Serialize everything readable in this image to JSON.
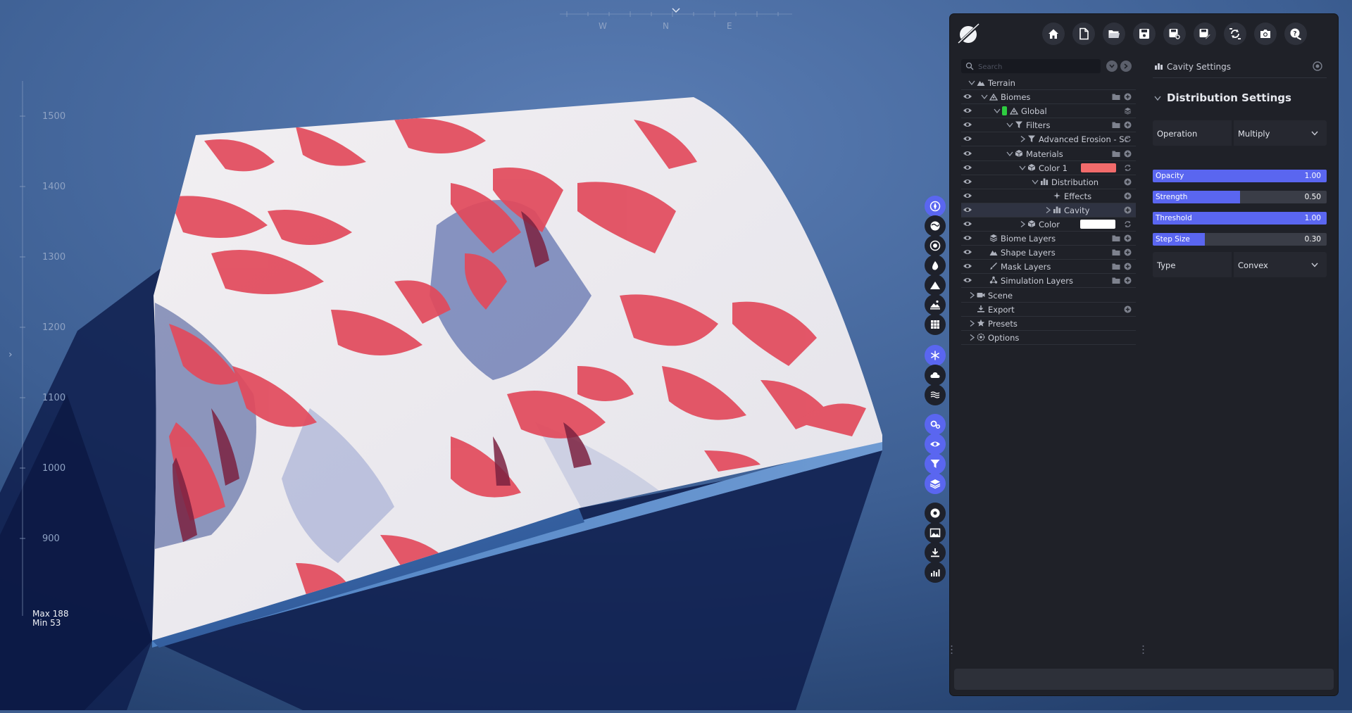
{
  "viewport": {
    "compass": [
      "W",
      "N",
      "E"
    ],
    "height_ruler": [
      "1500",
      "1400",
      "1300",
      "1200",
      "1100",
      "1000",
      "900"
    ],
    "max_label": "Max 188",
    "min_label": "Min 53"
  },
  "toolbar": {
    "buttons": [
      {
        "icon": "compass-icon",
        "active": true
      },
      {
        "icon": "globe-icon",
        "active": false
      },
      {
        "icon": "target-icon",
        "active": false
      },
      {
        "icon": "water-drop-icon",
        "active": false
      },
      {
        "icon": "mountain-icon",
        "active": false
      },
      {
        "icon": "landscape-icon",
        "active": false
      },
      {
        "icon": "grid-icon",
        "active": false
      },
      {
        "icon": "snowflake-icon",
        "active": true
      },
      {
        "icon": "cloud-icon",
        "active": false
      },
      {
        "icon": "waves-icon",
        "active": false
      },
      {
        "icon": "settings-cogs-icon",
        "active": true
      },
      {
        "icon": "eye-icon",
        "active": true
      },
      {
        "icon": "filter-icon",
        "active": true
      },
      {
        "icon": "layers-icon",
        "active": true
      },
      {
        "icon": "record-icon",
        "active": false
      },
      {
        "icon": "image-icon",
        "active": false
      },
      {
        "icon": "download-icon",
        "active": false
      },
      {
        "icon": "chart-icon",
        "active": false
      }
    ]
  },
  "topbar": {
    "icons": [
      "home-icon",
      "new-file-icon",
      "open-folder-icon",
      "save-icon",
      "save-settings-icon",
      "save-as-icon",
      "refresh-icon",
      "camera-icon",
      "help-icon"
    ]
  },
  "tree": {
    "search_placeholder": "Search",
    "rows": [
      {
        "label": "Terrain",
        "depth": 0,
        "eye": false,
        "chevron": "down",
        "icon": "mountain",
        "action": "none",
        "folder": false
      },
      {
        "label": "Biomes",
        "depth": 1,
        "eye": true,
        "chevron": "down",
        "icon": "biome",
        "action": "add",
        "folder": true
      },
      {
        "label": "Global",
        "depth": 2,
        "eye": true,
        "chevron": "down",
        "icon": "biome",
        "action": "layers",
        "folder": false,
        "marker": "#2ecc40"
      },
      {
        "label": "Filters",
        "depth": 3,
        "eye": true,
        "chevron": "down",
        "icon": "filter",
        "action": "add",
        "folder": true
      },
      {
        "label": "Advanced Erosion - Sc",
        "depth": 4,
        "eye": true,
        "chevron": "right",
        "icon": "filter",
        "action": "refresh",
        "folder": false
      },
      {
        "label": "Materials",
        "depth": 3,
        "eye": true,
        "chevron": "down",
        "icon": "cube",
        "action": "add",
        "folder": true
      },
      {
        "label": "Color 1",
        "depth": 4,
        "eye": true,
        "chevron": "down",
        "icon": "cube",
        "action": "refresh",
        "folder": false,
        "swatch": "#f26b6b"
      },
      {
        "label": "Distribution",
        "depth": 5,
        "eye": true,
        "chevron": "down",
        "icon": "distribution",
        "action": "add",
        "folder": false
      },
      {
        "label": "Effects",
        "depth": 6,
        "eye": true,
        "chevron": "none",
        "icon": "sparkle",
        "action": "add",
        "folder": false
      },
      {
        "label": "Cavity",
        "depth": 6,
        "eye": true,
        "chevron": "right",
        "icon": "distribution",
        "action": "add",
        "folder": false,
        "selected": true
      },
      {
        "label": "Color",
        "depth": 4,
        "eye": true,
        "chevron": "right",
        "icon": "cube",
        "action": "refresh",
        "folder": false,
        "swatch": "#ffffff"
      },
      {
        "label": "Biome Layers",
        "depth": 1,
        "eye": true,
        "chevron": "none",
        "icon": "layers",
        "action": "add",
        "folder": true
      },
      {
        "label": "Shape Layers",
        "depth": 1,
        "eye": true,
        "chevron": "none",
        "icon": "mountain",
        "action": "add",
        "folder": true
      },
      {
        "label": "Mask Layers",
        "depth": 1,
        "eye": true,
        "chevron": "none",
        "icon": "brush",
        "action": "add",
        "folder": true
      },
      {
        "label": "Simulation Layers",
        "depth": 1,
        "eye": true,
        "chevron": "none",
        "icon": "sim",
        "action": "add",
        "folder": true
      },
      {
        "label": "Scene",
        "depth": 0,
        "eye": false,
        "chevron": "right",
        "icon": "camera",
        "action": "none",
        "folder": false
      },
      {
        "label": "Export",
        "depth": 0,
        "eye": false,
        "chevron": "none",
        "icon": "download",
        "action": "add",
        "folder": false
      },
      {
        "label": "Presets",
        "depth": 0,
        "eye": false,
        "chevron": "right",
        "icon": "star",
        "action": "none",
        "folder": false
      },
      {
        "label": "Options",
        "depth": 0,
        "eye": false,
        "chevron": "right",
        "icon": "gear",
        "action": "none",
        "folder": false
      }
    ]
  },
  "settings": {
    "header": "Cavity Settings",
    "section_title": "Distribution Settings",
    "operation_label": "Operation",
    "operation_value": "Multiply",
    "sliders": [
      {
        "name": "Opacity",
        "value": "1.00",
        "fraction": 1.0
      },
      {
        "name": "Strength",
        "value": "0.50",
        "fraction": 0.5
      },
      {
        "name": "Threshold",
        "value": "1.00",
        "fraction": 1.0
      },
      {
        "name": "Step Size",
        "value": "0.30",
        "fraction": 0.3
      }
    ],
    "type_label": "Type",
    "type_value": "Convex"
  },
  "colors": {
    "accent": "#5a66f0",
    "panel": "#1f2128",
    "terrain_red": "#e8505f",
    "snow": "#f1eeee"
  }
}
